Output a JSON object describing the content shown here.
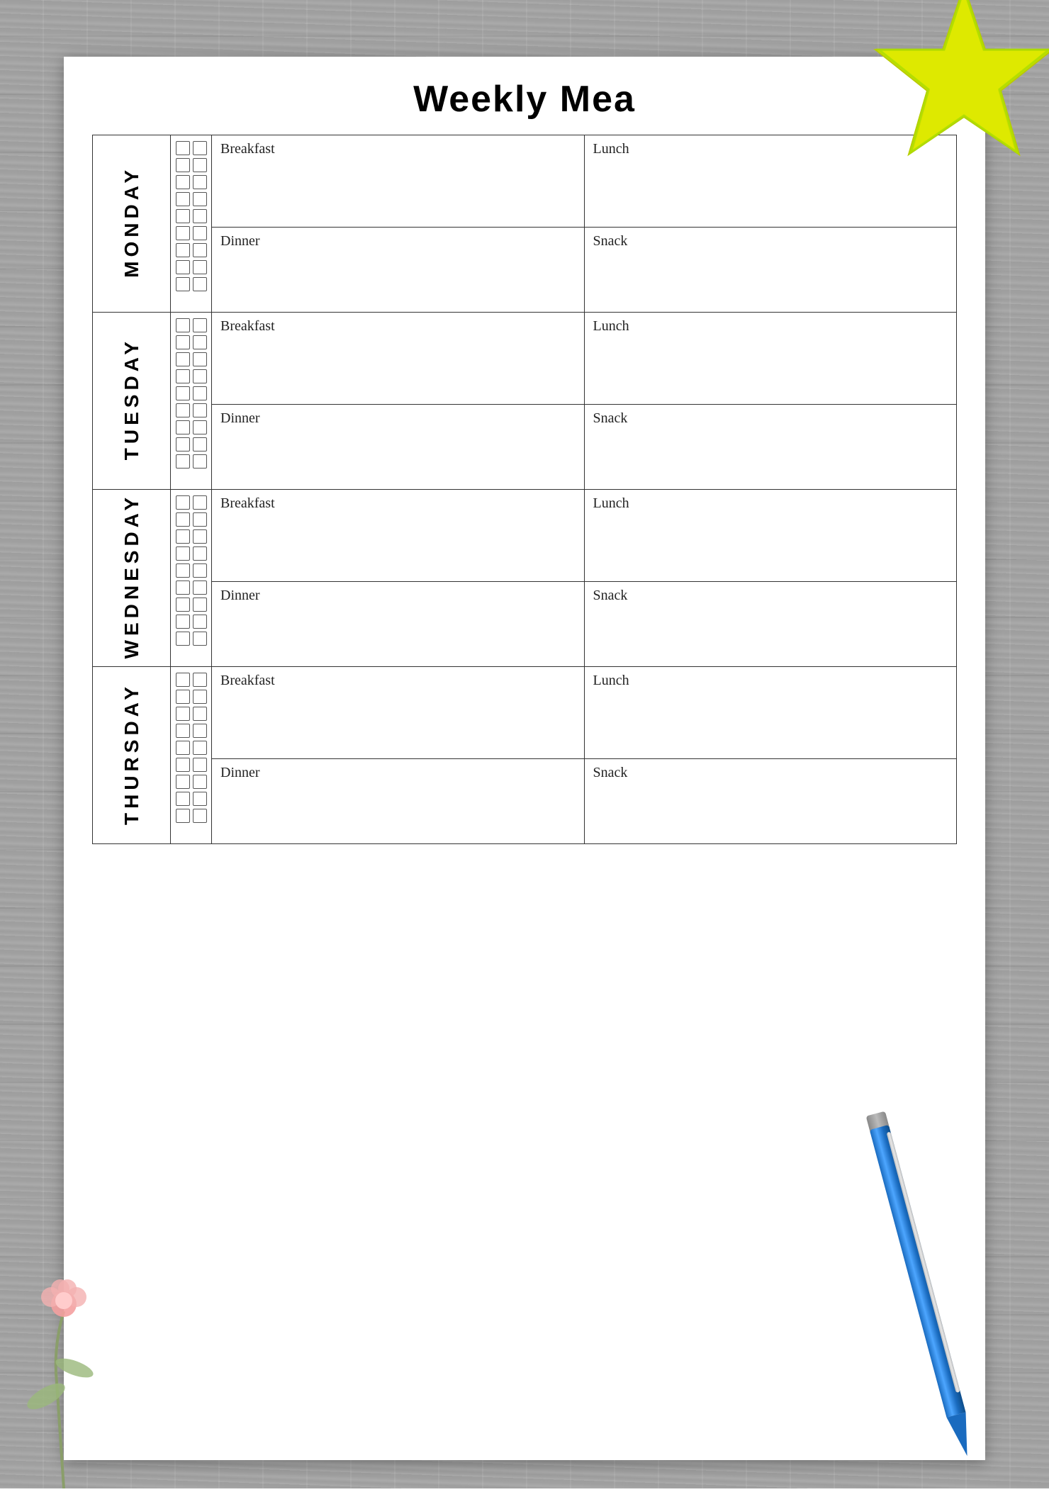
{
  "background": {
    "color": "#9a9a9a"
  },
  "title": "Weekly Mea",
  "days": [
    {
      "name": "MONDAY",
      "meals": [
        {
          "topLeft": "Breakfast",
          "topRight": "Lunch"
        },
        {
          "bottomLeft": "Dinner",
          "bottomRight": "Snack"
        }
      ]
    },
    {
      "name": "TUESDAY",
      "meals": [
        {
          "topLeft": "Breakfast",
          "topRight": "Lunch"
        },
        {
          "bottomLeft": "Dinner",
          "bottomRight": "Snack"
        }
      ]
    },
    {
      "name": "WEDNESDAY",
      "meals": [
        {
          "topLeft": "Breakfast",
          "topRight": "Lunch"
        },
        {
          "bottomLeft": "Dinner",
          "bottomRight": "Snack"
        }
      ]
    },
    {
      "name": "THURSDAY",
      "meals": [
        {
          "topLeft": "Breakfast",
          "topRight": "Lunch"
        },
        {
          "bottomLeft": "Dinner",
          "bottomRight": "Snack"
        }
      ]
    }
  ],
  "checkboxRows": 9,
  "checkboxCols": 2
}
